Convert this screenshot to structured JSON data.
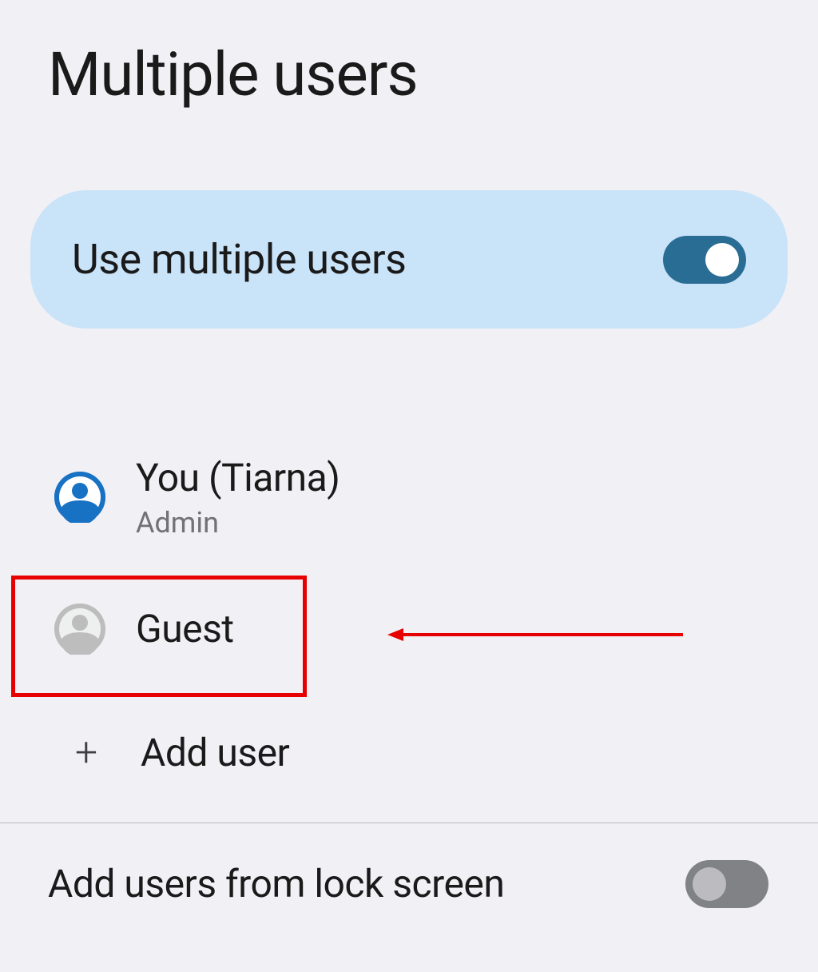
{
  "header": {
    "title": "Multiple users"
  },
  "toggle_card": {
    "label": "Use multiple users",
    "state": "on"
  },
  "users": [
    {
      "name": "You (Tiarna)",
      "role": "Admin",
      "avatar_type": "blue"
    },
    {
      "name": "Guest",
      "role": "",
      "avatar_type": "gray"
    }
  ],
  "add_user": {
    "label": "Add user"
  },
  "lock_screen": {
    "label": "Add users from lock screen",
    "state": "off"
  },
  "annotations": {
    "highlight_target": "guest",
    "arrow_color": "#e70000"
  }
}
